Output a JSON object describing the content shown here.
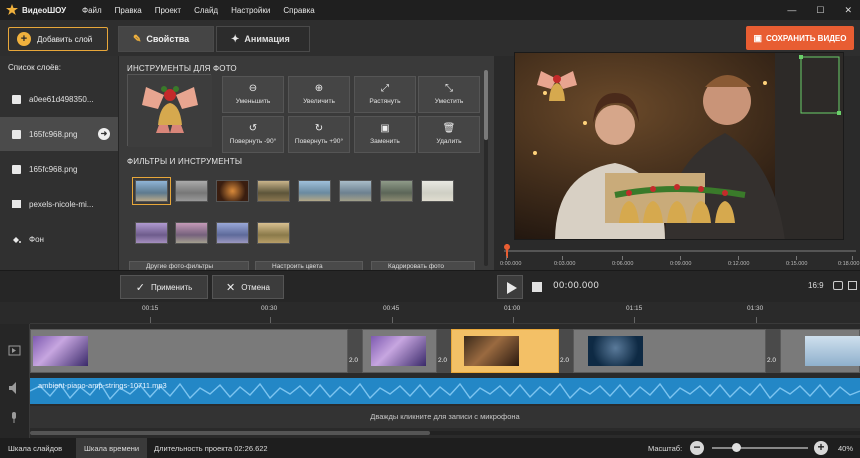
{
  "titlebar": {
    "app_name": "ВидеоШОУ",
    "menu": [
      "Файл",
      "Правка",
      "Проект",
      "Слайд",
      "Настройки",
      "Справка"
    ],
    "controls": [
      "minimize-icon",
      "maximize-icon",
      "close-icon"
    ]
  },
  "toolbar": {
    "add_layer": "Добавить слой",
    "tab_properties": "Свойства",
    "tab_animation": "Анимация",
    "save_video": "СОХРАНИТЬ ВИДЕО"
  },
  "layers": {
    "title": "Список слоёв:",
    "items": [
      {
        "label": "a0ee61d498350...",
        "icon": "image-icon",
        "selected": false
      },
      {
        "label": "165fc968.png",
        "icon": "image-icon",
        "selected": true
      },
      {
        "label": "165fc968.png",
        "icon": "image-icon",
        "selected": false
      },
      {
        "label": "pexels-nicole-mi...",
        "icon": "video-icon",
        "selected": false
      },
      {
        "label": "Фон",
        "icon": "fill-icon",
        "selected": false
      }
    ]
  },
  "photo_tools": {
    "title": "ИНСТРУМЕНТЫ ДЛЯ ФОТО",
    "tools": [
      {
        "label": "Уменьшить",
        "icon": "zoom-out-icon",
        "glyph": "🔍"
      },
      {
        "label": "Увеличить",
        "icon": "zoom-in-icon",
        "glyph": "🔍"
      },
      {
        "label": "Растянуть",
        "icon": "stretch-icon",
        "glyph": "⤢"
      },
      {
        "label": "Уместить",
        "icon": "fit-icon",
        "glyph": "⤡"
      },
      {
        "label": "Повернуть -90°",
        "icon": "rotate-left-icon",
        "glyph": "↺"
      },
      {
        "label": "Повернуть +90°",
        "icon": "rotate-right-icon",
        "glyph": "↻"
      },
      {
        "label": "Заменить",
        "icon": "replace-image-icon",
        "glyph": "▣"
      },
      {
        "label": "Удалить",
        "icon": "trash-icon",
        "glyph": "🗑"
      }
    ]
  },
  "filters": {
    "title": "ФИЛЬТРЫ И ИНСТРУМЕНТЫ",
    "bottom_buttons": [
      "Другие фото-фильтры",
      "Настроить цвета",
      "Кадрировать фото"
    ]
  },
  "preview": {
    "timecodes": [
      "0:00.000",
      "0:03.000",
      "0:06.000",
      "0:09.000",
      "0:12.000",
      "0:15.000",
      "0:18.000"
    ]
  },
  "actions": {
    "apply": "Применить",
    "cancel": "Отмена",
    "timecode": "00:00.000",
    "aspect": "16:9"
  },
  "timeline": {
    "ruler": [
      "00:15",
      "00:30",
      "00:45",
      "01:00",
      "01:15",
      "01:30"
    ],
    "transition_duration": "2.0",
    "audio_file": "ambient-piano-amp-strings-10711.mp3",
    "mic_hint": "Дважды кликните для записи с микрофона"
  },
  "statusbar": {
    "tab_slides": "Шкала слайдов",
    "tab_timeline": "Шкала времени",
    "duration": "Длительность проекта 02:26.622",
    "zoom_label": "Масштаб:",
    "zoom_value": "40%"
  },
  "colors": {
    "accent": "#e8a73a",
    "save": "#e85d32",
    "audio": "#2387c6",
    "active_clip": "#f3c066"
  }
}
